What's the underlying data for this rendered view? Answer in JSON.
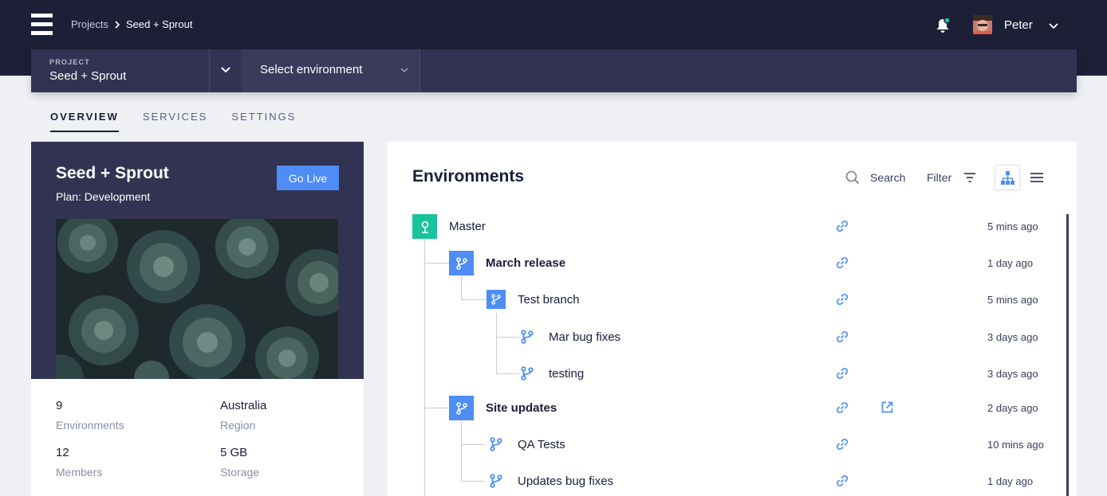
{
  "header": {
    "breadcrumbs": [
      "Projects",
      "Seed + Sprout"
    ],
    "user_name": "Peter"
  },
  "project_bar": {
    "project_label": "PROJECT",
    "project_value": "Seed + Sprout",
    "environment_placeholder": "Select environment"
  },
  "tabs": [
    "OVERVIEW",
    "SERVICES",
    "SETTINGS"
  ],
  "project_card": {
    "title": "Seed + Sprout",
    "plan": "Plan: Development",
    "go_live_label": "Go Live",
    "stats": [
      {
        "value": "9",
        "label": "Environments"
      },
      {
        "value": "Australia",
        "label": "Region"
      },
      {
        "value": "12",
        "label": "Members"
      },
      {
        "value": "5 GB",
        "label": "Storage"
      }
    ]
  },
  "environments": {
    "title": "Environments",
    "search_label": "Search",
    "filter_label": "Filter",
    "items": [
      {
        "name": "Master",
        "time": "5 mins ago",
        "level": 0,
        "icon": "master-icon"
      },
      {
        "name": "March release",
        "time": "1 day ago",
        "level": 1,
        "icon": "branch-icon"
      },
      {
        "name": "Test branch",
        "time": "5 mins ago",
        "level": 2,
        "icon": "branch-icon"
      },
      {
        "name": "Mar bug fixes",
        "time": "3 days ago",
        "level": 3,
        "icon": "branch-icon"
      },
      {
        "name": "testing",
        "time": "3 days ago",
        "level": 3,
        "icon": "branch-icon"
      },
      {
        "name": "Site updates",
        "time": "2 days ago",
        "level": 1,
        "icon": "branch-icon"
      },
      {
        "name": "QA Tests",
        "time": "10 mins ago",
        "level": 2,
        "icon": "branch-icon"
      },
      {
        "name": "Updates bug fixes",
        "time": "1 day ago",
        "level": 2,
        "icon": "branch-icon"
      }
    ]
  },
  "colors": {
    "header_bg": "#1d1f37",
    "bar_bg": "#323352",
    "accent_blue": "#4d8df5",
    "master_green": "#19c39c"
  }
}
